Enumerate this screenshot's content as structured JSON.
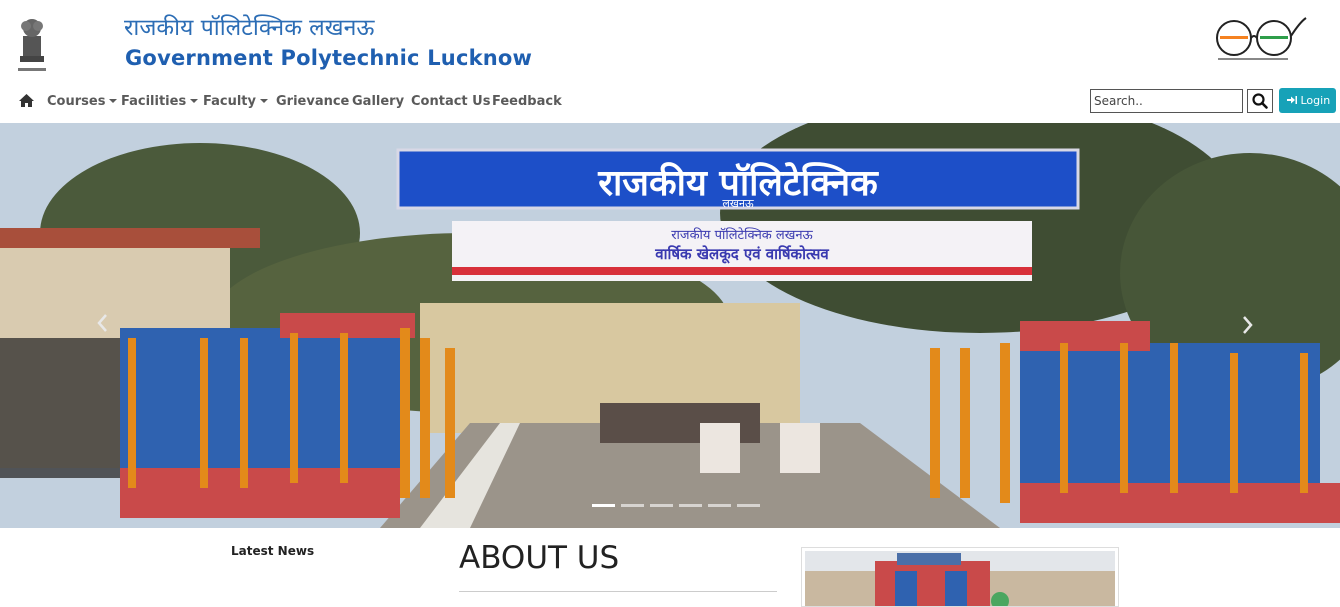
{
  "header": {
    "title_hindi": "राजकीय पॉलिटेक्निक लखनऊ",
    "title_english": "Government Polytechnic Lucknow",
    "emblem_icon": "national-emblem-icon",
    "swachh_icon": "swachh-bharat-logo-icon"
  },
  "nav": {
    "home_icon": "home-icon",
    "items": [
      {
        "label": "Courses",
        "dropdown": true
      },
      {
        "label": "Facilities",
        "dropdown": true
      },
      {
        "label": "Faculty",
        "dropdown": true
      },
      {
        "label": "Grievance",
        "dropdown": false
      },
      {
        "label": "Gallery",
        "dropdown": false
      },
      {
        "label": "Contact Us",
        "dropdown": false
      },
      {
        "label": "Feedback",
        "dropdown": false
      }
    ],
    "search_placeholder": "Search..",
    "login_label": "Login"
  },
  "carousel": {
    "banner_main": "राजकीय पॉलिटेक्निक",
    "banner_sub": "लखनऊ",
    "banner_cloth_line1": "राजकीय पॉलिटेक्निक लखनऊ",
    "banner_cloth_line2": "वार्षिक खेलकूद एवं वार्षिकोत्सव",
    "slide_count": 6,
    "active_slide": 1
  },
  "main": {
    "latest_news_heading": "Latest News",
    "about_heading": "ABOUT US"
  },
  "colors": {
    "brand_blue": "#1f5fb0",
    "login_teal": "#17a2b8",
    "nav_text": "#5a5a5a"
  }
}
